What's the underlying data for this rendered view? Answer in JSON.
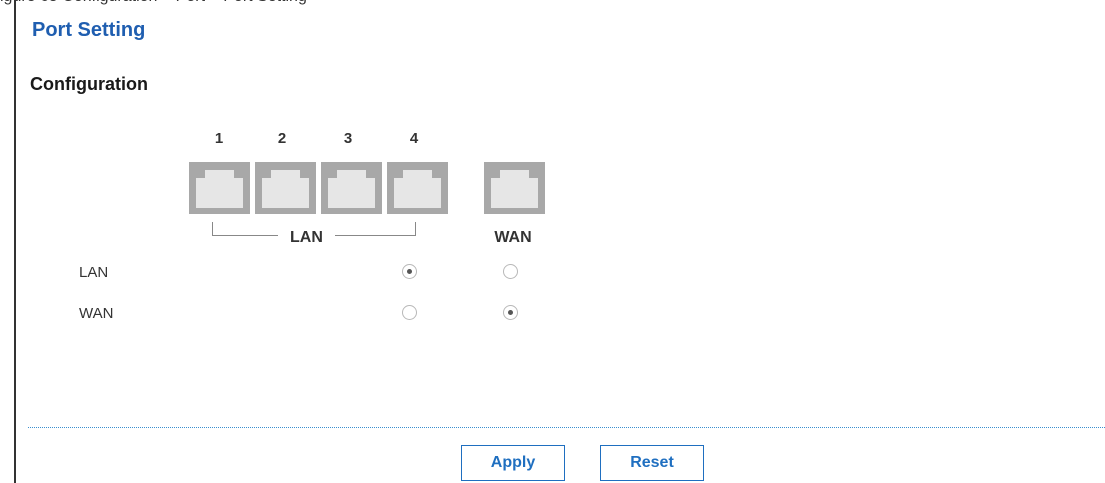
{
  "caption": "igure 65  Configuration > Port > Port Setting",
  "page_title": "Port Setting",
  "section_title": "Configuration",
  "ports": {
    "numbers": [
      "1",
      "2",
      "3",
      "4"
    ],
    "lan_group_label": "LAN",
    "wan_label": "WAN"
  },
  "rows": [
    {
      "label": "LAN",
      "lan_selected": true,
      "wan_selected": false
    },
    {
      "label": "WAN",
      "lan_selected": false,
      "wan_selected": true
    }
  ],
  "buttons": {
    "apply": "Apply",
    "reset": "Reset"
  },
  "colors": {
    "title": "#1f5eb0",
    "button": "#1f6fc0",
    "divider": "#3a8fd0"
  }
}
